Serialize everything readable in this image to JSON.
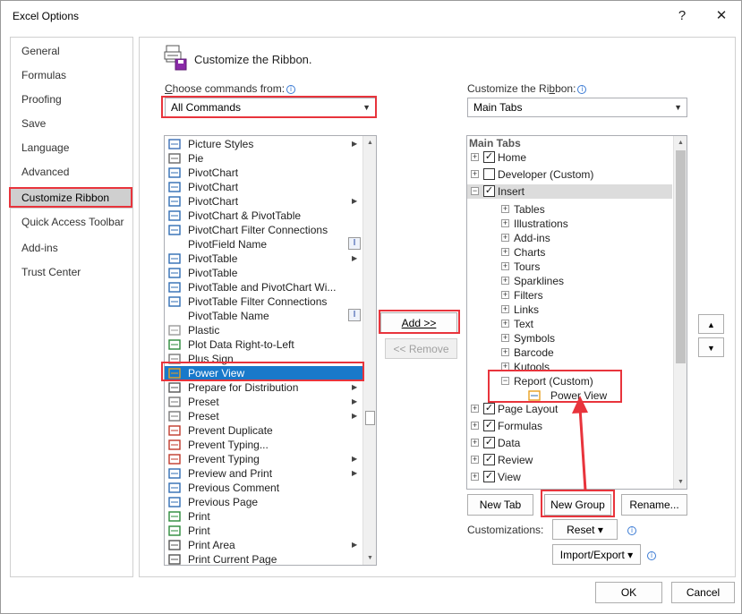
{
  "window": {
    "title": "Excel Options",
    "help": "?",
    "close": "✕"
  },
  "nav": {
    "items": [
      {
        "label": "General"
      },
      {
        "label": "Formulas"
      },
      {
        "label": "Proofing"
      },
      {
        "label": "Save"
      },
      {
        "label": "Language"
      },
      {
        "label": "Advanced"
      },
      {
        "label": "Customize Ribbon"
      },
      {
        "label": "Quick Access Toolbar"
      },
      {
        "label": "Add-ins"
      },
      {
        "label": "Trust Center"
      }
    ]
  },
  "section": {
    "title": "Customize the Ribbon."
  },
  "left": {
    "label_pre": "",
    "label_u": "C",
    "label_post": "hoose commands from:",
    "combo_value": "All Commands",
    "commands": [
      {
        "label": "Picture Styles",
        "sub": true
      },
      {
        "label": "Pie",
        "sub": false
      },
      {
        "label": "PivotChart",
        "sub": false
      },
      {
        "label": "PivotChart",
        "sub": false
      },
      {
        "label": "PivotChart",
        "sub": true
      },
      {
        "label": "PivotChart & PivotTable",
        "sub": false
      },
      {
        "label": "PivotChart Filter Connections",
        "sub": false
      },
      {
        "label": "PivotField Name",
        "sub": false
      },
      {
        "label": "PivotTable",
        "sub": true
      },
      {
        "label": "PivotTable",
        "sub": false
      },
      {
        "label": "PivotTable and PivotChart Wi...",
        "sub": false
      },
      {
        "label": "PivotTable Filter Connections",
        "sub": false
      },
      {
        "label": "PivotTable Name",
        "sub": false
      },
      {
        "label": "Plastic",
        "sub": false
      },
      {
        "label": "Plot Data Right-to-Left",
        "sub": false
      },
      {
        "label": "Plus Sign",
        "sub": false
      },
      {
        "label": "Power View",
        "sub": false
      },
      {
        "label": "Prepare for Distribution",
        "sub": true
      },
      {
        "label": "Preset",
        "sub": true
      },
      {
        "label": "Preset",
        "sub": true
      },
      {
        "label": "Prevent Duplicate",
        "sub": false
      },
      {
        "label": "Prevent Typing...",
        "sub": false
      },
      {
        "label": "Prevent Typing",
        "sub": true
      },
      {
        "label": "Preview and Print",
        "sub": true
      },
      {
        "label": "Previous Comment",
        "sub": false
      },
      {
        "label": "Previous Page",
        "sub": false
      },
      {
        "label": "Print",
        "sub": false
      },
      {
        "label": "Print",
        "sub": false
      },
      {
        "label": "Print Area",
        "sub": true
      },
      {
        "label": "Print Current Page",
        "sub": false
      }
    ],
    "text_marker": "I"
  },
  "middle": {
    "add_label": "Add >>",
    "remove_label": "<< Remove"
  },
  "right": {
    "label_pre": "Customize the Ri",
    "label_u": "b",
    "label_post": "bon:",
    "combo_value": "Main Tabs",
    "header": "Main Tabs",
    "tree": [
      {
        "label": "Home",
        "level": 0,
        "toggle": "+",
        "checked": true
      },
      {
        "label": "Developer (Custom)",
        "level": 0,
        "toggle": "+",
        "checked": false
      },
      {
        "label": "Insert",
        "level": 0,
        "toggle": "−",
        "checked": true
      },
      {
        "label": "Tables",
        "level": 1,
        "toggle": "+"
      },
      {
        "label": "Illustrations",
        "level": 1,
        "toggle": "+"
      },
      {
        "label": "Add-ins",
        "level": 1,
        "toggle": "+"
      },
      {
        "label": "Charts",
        "level": 1,
        "toggle": "+"
      },
      {
        "label": "Tours",
        "level": 1,
        "toggle": "+"
      },
      {
        "label": "Sparklines",
        "level": 1,
        "toggle": "+"
      },
      {
        "label": "Filters",
        "level": 1,
        "toggle": "+"
      },
      {
        "label": "Links",
        "level": 1,
        "toggle": "+"
      },
      {
        "label": "Text",
        "level": 1,
        "toggle": "+"
      },
      {
        "label": "Symbols",
        "level": 1,
        "toggle": "+"
      },
      {
        "label": "Barcode",
        "level": 1,
        "toggle": "+"
      },
      {
        "label": "Kutools",
        "level": 1,
        "toggle": "+"
      },
      {
        "label": "Report (Custom)",
        "level": 1,
        "toggle": "−"
      },
      {
        "label": "Power View",
        "level": 2,
        "toggle": ""
      },
      {
        "label": "Page Layout",
        "level": 0,
        "toggle": "+",
        "checked": true
      },
      {
        "label": "Formulas",
        "level": 0,
        "toggle": "+",
        "checked": true
      },
      {
        "label": "Data",
        "level": 0,
        "toggle": "+",
        "checked": true
      },
      {
        "label": "Review",
        "level": 0,
        "toggle": "+",
        "checked": true
      },
      {
        "label": "View",
        "level": 0,
        "toggle": "+",
        "checked": true
      }
    ],
    "new_tab_label": "New Tab",
    "new_group_label": "New Group",
    "rename_label": "Rename...",
    "customizations_label": "Customizations:",
    "reset_label": "Reset ▾",
    "import_export_label": "Import/Export ▾",
    "move_up": "▲",
    "move_down": "▼"
  },
  "footer": {
    "ok_label": "OK",
    "cancel_label": "Cancel"
  },
  "colors": {
    "highlight": "#e8343c",
    "selection": "#1979ca"
  }
}
